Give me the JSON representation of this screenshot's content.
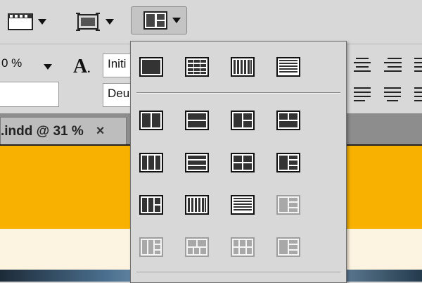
{
  "toolbar": {
    "items": [
      {
        "icon": "screen-mode-icon"
      },
      {
        "icon": "frame-view-icon"
      },
      {
        "icon": "arrange-documents-icon",
        "active": true
      }
    ]
  },
  "controls": {
    "zoom_value": "0 %",
    "field_top": "Initi",
    "field_bottom": "Deu"
  },
  "tab": {
    "label": ".indd @ 31 %",
    "close": "×"
  },
  "arrange_menu": {
    "rows": [
      [
        "consolidate-all",
        "tile-all-in-grid",
        "tile-all-vertically",
        "tile-all-horizontally"
      ],
      [
        "2-up-vertical",
        "2-up-horizontal",
        "3-up-vertical",
        "3-up-horizontal"
      ],
      [
        "3-up-columns",
        "3-up-stacked",
        "4-up-grid",
        "4-up-mixed"
      ],
      [
        "5-up-mixed",
        "6-up-columns",
        "6-up-rows",
        "5-up-disabled"
      ],
      [
        "5-up-disabled",
        "6-up-grid-disabled",
        "6-up-grid-disabled",
        "6-up-mixed-disabled"
      ]
    ],
    "disabled": [
      [
        3,
        3
      ],
      [
        4,
        0
      ],
      [
        4,
        1
      ],
      [
        4,
        2
      ],
      [
        4,
        3
      ]
    ]
  },
  "colors": {
    "accent_band": "#f8b100",
    "cream_band": "#fdf3e1",
    "toolbar_bg": "#d8d8d8",
    "tab_strip": "#8d8d8d"
  }
}
